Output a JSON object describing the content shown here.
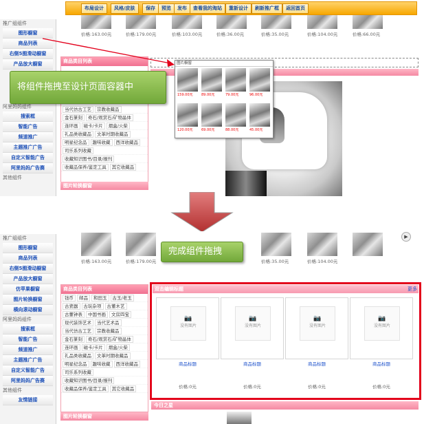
{
  "toolbar": {
    "buttons": [
      "布局设计",
      "风格/皮肤",
      "保存",
      "预览",
      "发布",
      "查看我的淘站",
      "重新设计",
      "刷新推广框",
      "返回首页"
    ]
  },
  "sidebar": {
    "section1_title": "推广组组件",
    "items1": [
      "图形橱窗",
      "商品列表",
      "右侧5图滑动橱窗",
      "产品放大橱窗"
    ],
    "section2_title": "阿里妈妈组件",
    "items2_top": [
      "搜索框",
      "智能广告",
      "频道推广",
      "主题推广广告",
      "自定义智能广告",
      "阿里妈妈广告赛"
    ],
    "section3_title": "其他组件",
    "p2_items1": [
      "图形橱窗",
      "商品列表",
      "右侧5图滑动橱窗",
      "产品放大橱窗",
      "仿苹果橱窗",
      "图片轮换橱窗",
      "横向滚动橱窗"
    ],
    "p2_items2": [
      "搜索框",
      "智能广告",
      "频道推广",
      "主题推广广告",
      "自定义智能广告",
      "阿里妈妈广告赛"
    ],
    "p2_items3": [
      "友情链接"
    ]
  },
  "products_row1": [
    "价格:163.00元",
    "价格:179.00元",
    "价格:103.00元",
    "价格:36.00元",
    "价格:35.00元",
    "价格:104.00元",
    "价格:66.00元"
  ],
  "products_row2": [
    "价格:163.00元",
    "价格:179.00元",
    "价格:35.00元",
    "价格:104.00元"
  ],
  "category": {
    "title": "商品类目列表",
    "rows_p1": [
      [
        "当代仿古工艺",
        "宗教收藏品"
      ],
      [
        "金石篆刻",
        "奇石/观赏石/矿物晶体"
      ],
      [
        "连环画",
        "磁卡/卡片",
        "烟盒/火柴"
      ],
      [
        "礼品类收藏品",
        "文革时期收藏品"
      ],
      [
        "明星纪念品",
        "趣味收藏",
        "西洋收藏品"
      ],
      [
        "司乐系列收藏"
      ],
      [
        "收藏知识图书/目录/报刊"
      ],
      [
        "收藏品保养/鉴定工具",
        "其它收藏品"
      ]
    ],
    "rows_p2": [
      [
        "钱币",
        "邮品",
        "和田玉",
        "古玉/老玉"
      ],
      [
        "古瓷器",
        "古玩杂项",
        "古董木艺"
      ],
      [
        "古董钟表",
        "中国书画",
        "文房四宝"
      ],
      [
        "现代装饰艺术",
        "当代艺术品"
      ],
      [
        "当代仿古工艺",
        "宗教收藏品"
      ],
      [
        "金石篆刻",
        "奇石/观赏石/矿物晶体"
      ],
      [
        "连环画",
        "磁卡/卡片",
        "烟盒/火柴"
      ],
      [
        "礼品类收藏品",
        "文革时期收藏品"
      ],
      [
        "明星纪念品",
        "趣味收藏",
        "西洋收藏品"
      ],
      [
        "司乐系列收藏"
      ],
      [
        "收藏知识图书/目录/报刊"
      ],
      [
        "收藏品保养/鉴定工具",
        "其它收藏品"
      ]
    ],
    "picture_rotation": "图片轮换橱窗"
  },
  "callout1": "将组件拖拽至设计页面容器中",
  "callout2": "完成组件拖拽",
  "popup_title": "图片橱窗",
  "popup_prices": [
    "159.00元",
    "89.00元",
    "79.00元",
    "96.00元",
    "120.00元",
    "69.00元",
    "88.00元",
    "45.00元"
  ],
  "redbox": {
    "title": "双击编辑标题",
    "more": "更多",
    "no_image": "没有图片",
    "slot_title": "商品标题",
    "slot_price": "价格:0元"
  },
  "today": "今日之星"
}
